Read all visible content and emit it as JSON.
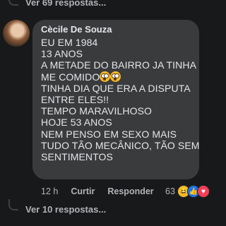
{
  "top_replies": {
    "label": "Ver 69 respostas..."
  },
  "comment": {
    "author": "Cècile De Souza",
    "lines": [
      "EU EM 1984",
      "13 ANOS",
      "A METADE DO BAIRRO JA TINHA",
      "ME COMIDO",
      "TINHA DIA QUE ERA A DISPUTA",
      "ENTRE ELES!!",
      "TEMPO MARAVILHOSO",
      "HOJE 53 ANOS",
      "NEM PENSO EM SEXO MAIS",
      "TUDO TÃO MECÂNICO, TÃO SEM",
      "SENTIMENTOS"
    ],
    "inline_emojis": [
      "flushed-face",
      "flushed-face"
    ],
    "time": "12 h",
    "actions": {
      "like": "Curtir",
      "reply": "Responder"
    },
    "reactions": {
      "count": "63",
      "types": [
        "haha",
        "like",
        "love"
      ]
    }
  },
  "bottom_replies": {
    "label": "Ver 10 respostas..."
  },
  "colors": {
    "background": "#18191a",
    "bubble": "#3a3b3c",
    "text": "#e4e6eb",
    "muted": "#b0b3b8"
  }
}
